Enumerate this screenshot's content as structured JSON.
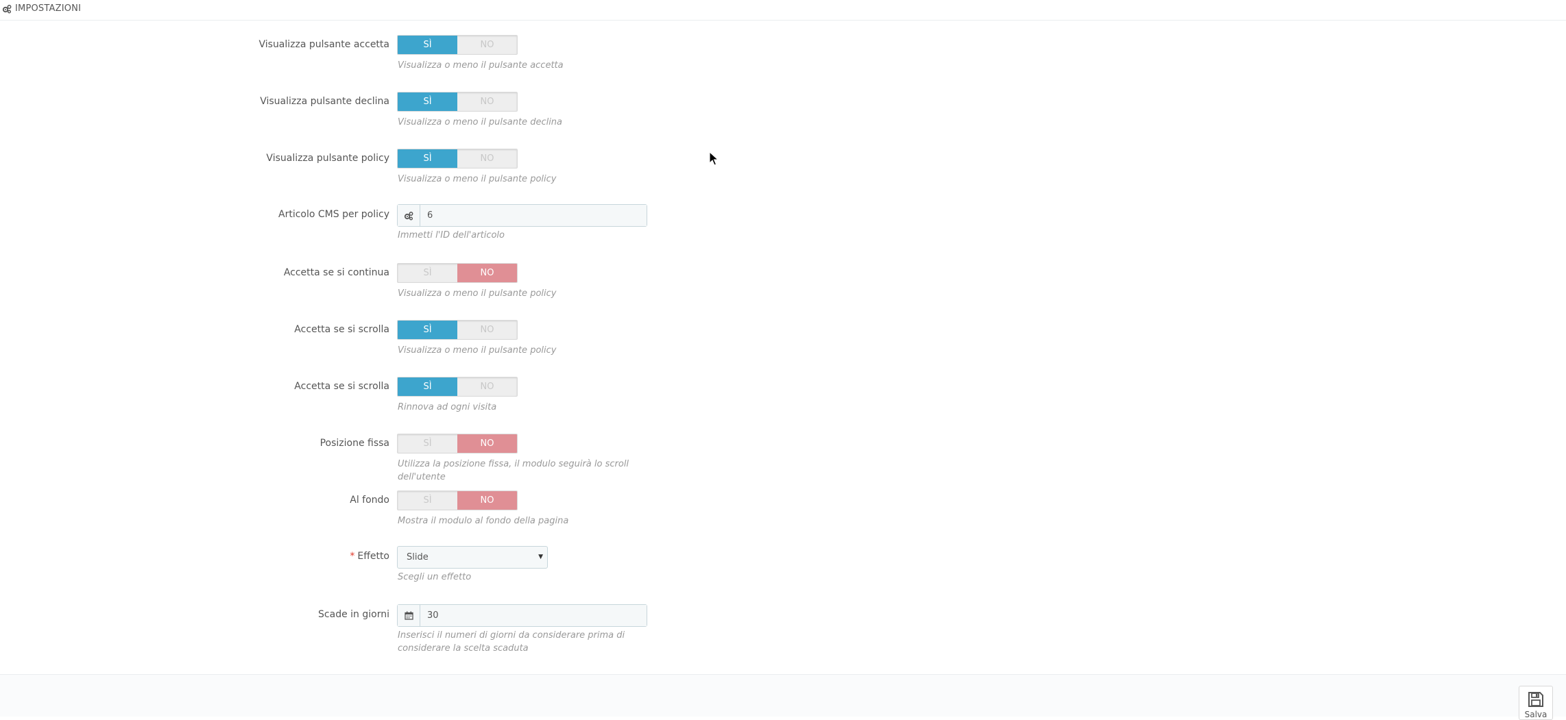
{
  "header": {
    "title": "IMPOSTAZIONI",
    "icon": "gears-icon"
  },
  "fields": [
    {
      "id": "accept",
      "label": "Visualizza pulsante accetta",
      "type": "switch",
      "on": "Sì",
      "off": "NO",
      "value": "Sì",
      "help": "Visualizza o meno il pulsante accetta"
    },
    {
      "id": "decline",
      "label": "Visualizza pulsante declina",
      "type": "switch",
      "on": "Sì",
      "off": "NO",
      "value": "Sì",
      "help": "Visualizza o meno il pulsante declina"
    },
    {
      "id": "policy",
      "label": "Visualizza pulsante policy",
      "type": "switch",
      "on": "Sì",
      "off": "NO",
      "value": "Sì",
      "help": "Visualizza o meno il pulsante policy"
    },
    {
      "id": "cms",
      "label": "Articolo CMS per policy",
      "type": "input",
      "icon": "gears-icon",
      "value": "6",
      "help": "Immetti l'ID dell'articolo"
    },
    {
      "id": "continue",
      "label": "Accetta se si continua",
      "type": "switch",
      "on": "Sì",
      "off": "NO",
      "value": "NO",
      "help": "Visualizza o meno il pulsante policy"
    },
    {
      "id": "scroll",
      "label": "Accetta se si scrolla",
      "type": "switch",
      "on": "Sì",
      "off": "NO",
      "value": "Sì",
      "help": "Visualizza o meno il pulsante policy"
    },
    {
      "id": "scroll2",
      "label": "Accetta se si scrolla",
      "type": "switch",
      "on": "Sì",
      "off": "NO",
      "value": "Sì",
      "help": "Rinnova ad ogni visita"
    },
    {
      "id": "fixed",
      "label": "Posizione fissa",
      "type": "switch",
      "on": "Sì",
      "off": "NO",
      "value": "NO",
      "help": "Utilizza la posizione fissa, il modulo seguirà lo scroll dell'utente"
    },
    {
      "id": "bottom",
      "label": "Al fondo",
      "type": "switch",
      "on": "Sì",
      "off": "NO",
      "value": "NO",
      "help": "Mostra il modulo al fondo della pagina"
    },
    {
      "id": "effect",
      "label": "Effetto",
      "required": "*",
      "type": "select",
      "value": "Slide",
      "help": "Scegli un effetto"
    },
    {
      "id": "expire",
      "label": "Scade in giorni",
      "type": "input",
      "icon": "calendar-icon",
      "value": "30",
      "help": "Inserisci il numeri di giorni da considerare prima di considerare la scelta scaduta"
    }
  ],
  "footer": {
    "save_label": "Salva",
    "save_icon": "floppy-disk-icon"
  },
  "colors": {
    "switch_on": "#3da5cd",
    "switch_no": "#e08f95",
    "required": "#e0392b"
  }
}
